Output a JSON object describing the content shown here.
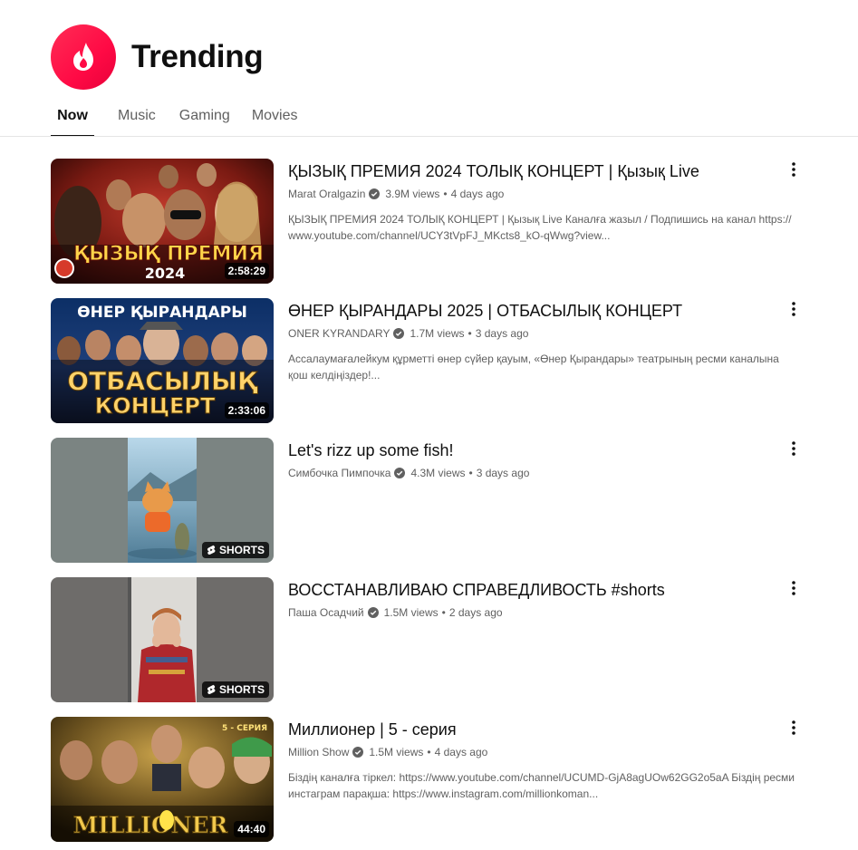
{
  "header": {
    "title": "Trending",
    "logo_icon": "trending-flame-icon",
    "accent": "#ff0a45"
  },
  "tabs": [
    {
      "label": "Now",
      "active": true
    },
    {
      "label": "Music",
      "active": false
    },
    {
      "label": "Gaming",
      "active": false
    },
    {
      "label": "Movies",
      "active": false
    }
  ],
  "videos": [
    {
      "title": "ҚЫЗЫҚ ПРЕМИЯ 2024 ТОЛЫҚ КОНЦЕРТ | Қызық Live",
      "channel": "Marat Oralgazin",
      "verified": true,
      "views": "3.9M views",
      "age": "4 days ago",
      "description_lines": [
        "ҚЫЗЫҚ ПРЕМИЯ 2024 ТОЛЫҚ КОНЦЕРТ | Қызық Live Каналға жазыл / Подпишись на канал https://",
        "www.youtube.com/channel/UCY3tVpFJ_MKcts8_kO-qWwg?view..."
      ],
      "duration": "2:58:29",
      "thumb_text": [
        "ҚЫЗЫҚ ПРЕМИЯ",
        "2024"
      ]
    },
    {
      "title": "ӨНЕР ҚЫРАНДАРЫ 2025 | ОТБАСЫЛЫҚ КОНЦЕРТ",
      "channel": "ONER KYRANDARY",
      "verified": true,
      "views": "1.7M views",
      "age": "3 days ago",
      "description_lines": [
        "Ассалаумағалейкум құрметті өнер сүйер қауым, «Өнер Қырандары» театрының ресми каналына",
        "қош келдіңіздер!..."
      ],
      "duration": "2:33:06",
      "thumb_text": [
        "ӨНЕР ҚЫРАНДАРЫ",
        "ОТБАСЫЛЫҚ",
        "КОНЦЕРТ"
      ]
    },
    {
      "title": "Let's rizz up some fish!",
      "channel": "Симбочка Пимпочка",
      "verified": true,
      "views": "4.3M views",
      "age": "3 days ago",
      "description_lines": [],
      "badge": "SHORTS"
    },
    {
      "title": "ВОССТАНАВЛИВАЮ СПРАВЕДЛИВОСТЬ #shorts",
      "channel": "Паша Осадчий",
      "verified": true,
      "views": "1.5M views",
      "age": "2 days ago",
      "description_lines": [],
      "badge": "SHORTS"
    },
    {
      "title": "Миллионер | 5 - серия",
      "channel": "Million Show",
      "verified": true,
      "views": "1.5M views",
      "age": "4 days ago",
      "description_lines": [
        "Біздің каналға тіркел: https://www.youtube.com/channel/UCUMD-GjA8agUOw62GG2o5aA Біздің ресми",
        "инстаграм парақша: https://www.instagram.com/millionkoman..."
      ],
      "duration": "44:40",
      "thumb_text": [
        "MILLIONER",
        "5 - СЕРИЯ"
      ]
    }
  ]
}
